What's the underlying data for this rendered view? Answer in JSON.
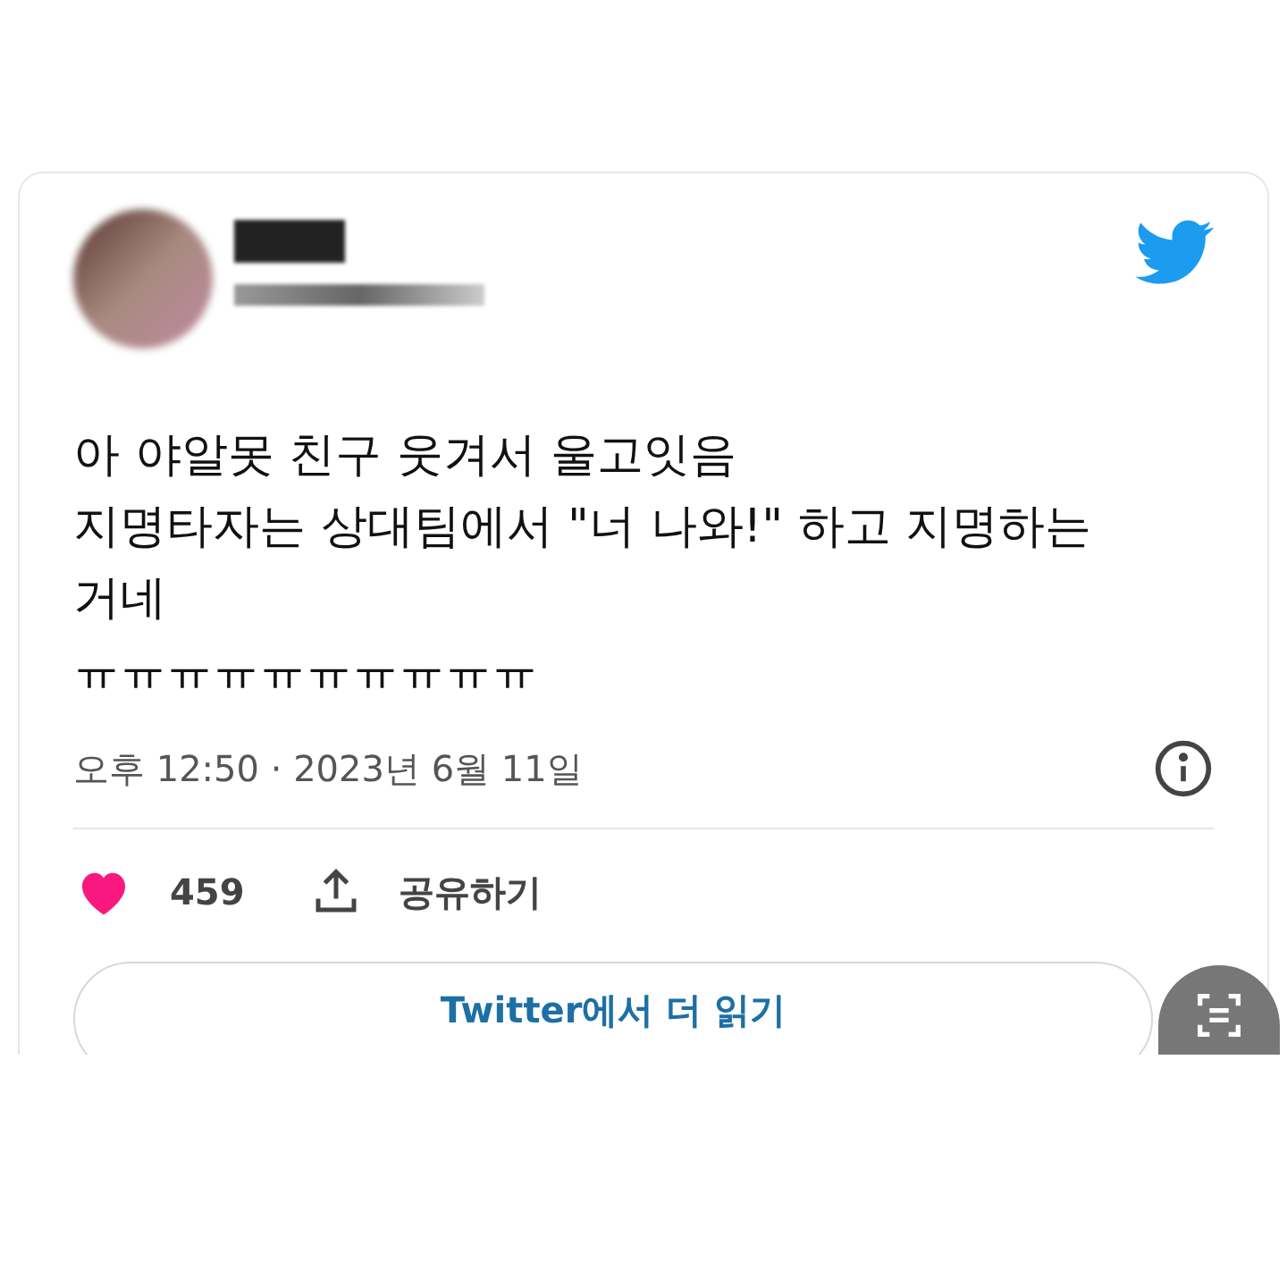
{
  "tweet": {
    "lines": [
      "아 야알못 친구 웃겨서 울고잇음",
      "지명타자는 상대팀에서 \"너 나와!\" 하고 지명하는",
      "거네",
      "ㅠㅠㅠㅠㅠㅠㅠㅠㅠㅠ"
    ],
    "timestamp": "오후 12:50 · 2023년 6월 11일",
    "likes": "459",
    "share": "공유하기",
    "read_more": "Twitter에서 더 읽기"
  }
}
